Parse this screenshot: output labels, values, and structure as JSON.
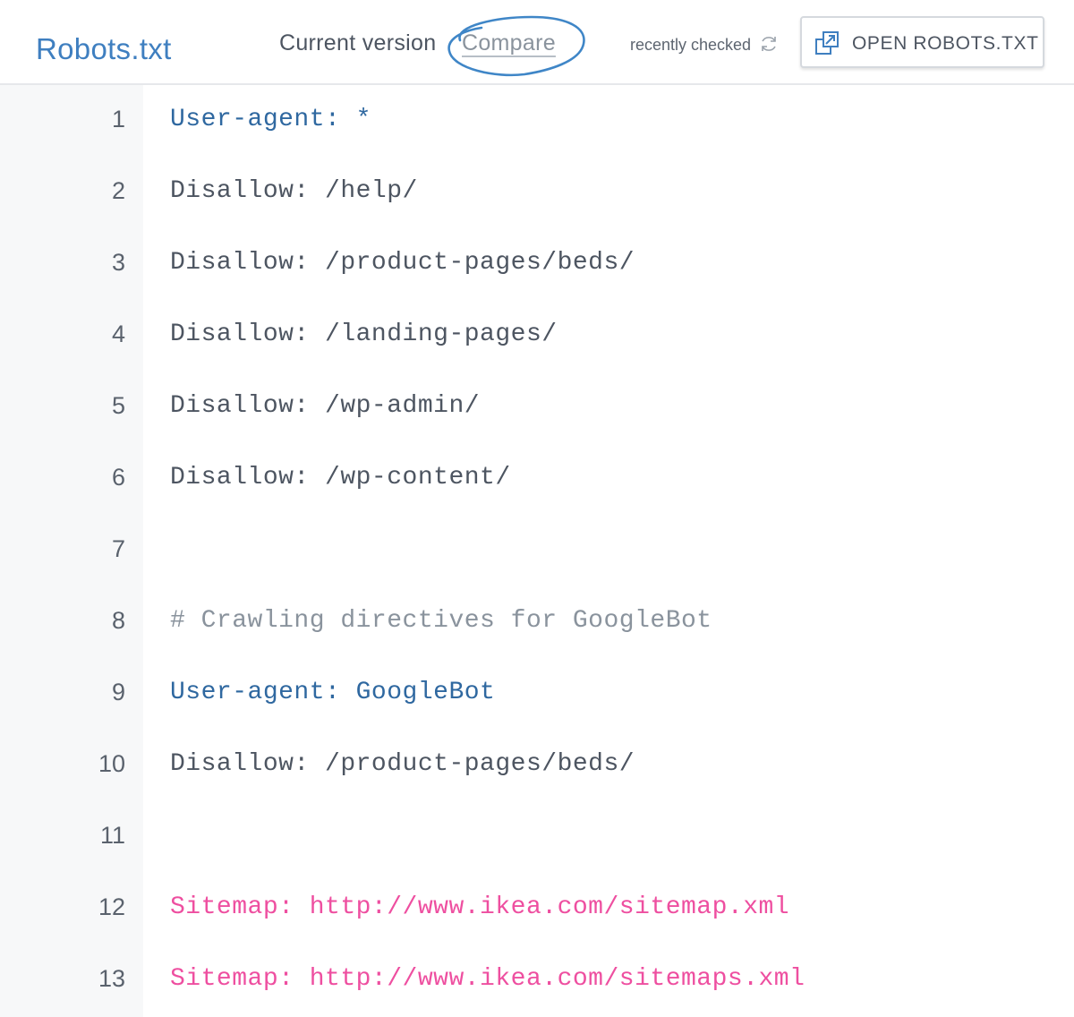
{
  "header": {
    "title": "Robots.txt",
    "current_version_label": "Current version",
    "compare_label": "Compare",
    "recently_checked": "recently checked",
    "open_button_label": "OPEN ROBOTS.TXT"
  },
  "colors": {
    "title": "#3f7fc0",
    "annotation_circle": "#3f86c7",
    "user_agent": "#2f68a0",
    "disallow": "#4d5561",
    "comment": "#8a939d",
    "sitemap": "#ee4fa0",
    "gutter_bg": "#f7f8f9"
  },
  "icons": {
    "refresh": "refresh-icon",
    "open_external": "open-external-icon"
  },
  "lines": [
    {
      "num": "1",
      "text": "User-agent: *",
      "kind": "agent"
    },
    {
      "num": "2",
      "text": "Disallow: /help/",
      "kind": "disallow"
    },
    {
      "num": "3",
      "text": "Disallow: /product-pages/beds/",
      "kind": "disallow"
    },
    {
      "num": "4",
      "text": "Disallow: /landing-pages/",
      "kind": "disallow"
    },
    {
      "num": "5",
      "text": "Disallow: /wp-admin/",
      "kind": "disallow"
    },
    {
      "num": "6",
      "text": "Disallow: /wp-content/",
      "kind": "disallow"
    },
    {
      "num": "7",
      "text": "",
      "kind": "blank"
    },
    {
      "num": "8",
      "text": "# Crawling directives for GoogleBot",
      "kind": "comment"
    },
    {
      "num": "9",
      "text": "User-agent: GoogleBot",
      "kind": "agent"
    },
    {
      "num": "10",
      "text": "Disallow: /product-pages/beds/",
      "kind": "disallow"
    },
    {
      "num": "11",
      "text": "",
      "kind": "blank"
    },
    {
      "num": "12",
      "text": "Sitemap: http://www.ikea.com/sitemap.xml",
      "kind": "sitemap"
    },
    {
      "num": "13",
      "text": "Sitemap: http://www.ikea.com/sitemaps.xml",
      "kind": "sitemap"
    }
  ]
}
